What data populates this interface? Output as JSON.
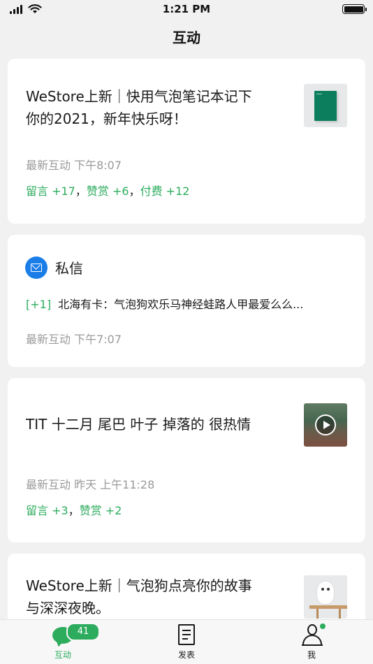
{
  "status_bar": {
    "time": "1:21 PM"
  },
  "nav": {
    "title": "互动"
  },
  "cards": [
    {
      "title_line1": "WeStore上新｜快用气泡笔记本记下",
      "title_line2": "你的2021，新年快乐呀！",
      "meta": "最新互动  下午8:07",
      "stats": [
        {
          "label": "留言 +17"
        },
        {
          "label": "赞赏 +6"
        },
        {
          "label": "付费 +12"
        }
      ]
    },
    {
      "title": "私信",
      "count": "[+1]",
      "preview": "北海有卡：气泡狗欢乐马神经蛙路人甲最爱么么...",
      "meta": "最新互动   下午7:07"
    },
    {
      "title": "TIT 十二月 尾巴 叶子 掉落的 很热情",
      "meta": "最新互动 昨天 上午11:28",
      "stats": [
        {
          "label": "留言 +3"
        },
        {
          "label": "赞赏 +2"
        }
      ]
    },
    {
      "title_line1": "WeStore上新｜气泡狗点亮你的故事",
      "title_line2": "与深深夜晚。"
    }
  ],
  "tab_bar": {
    "tabs": [
      {
        "label": "互动",
        "badge": "41",
        "icon": "chat-bubble-icon"
      },
      {
        "label": "发表",
        "icon": "document-icon"
      },
      {
        "label": "我",
        "icon": "person-icon"
      }
    ]
  },
  "colors": {
    "accent": "#2dac5e",
    "mail": "#1b7ee8",
    "background": "#f1f1f1"
  }
}
